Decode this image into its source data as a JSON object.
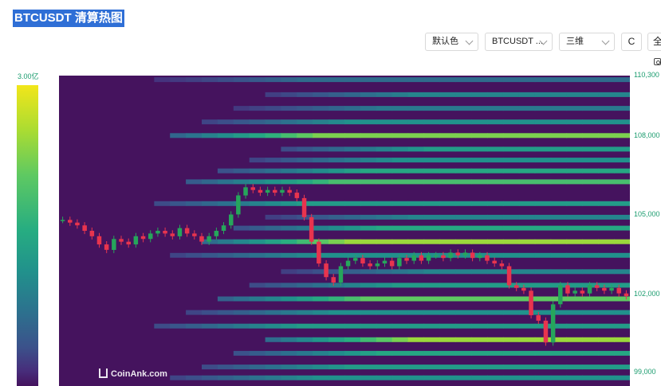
{
  "header": {
    "title": "BTCUSDT 清算热图"
  },
  "toolbar": {
    "color_scheme": "默认色",
    "symbol": "BTCUSDT ...",
    "view_mode": "三维",
    "refresh_icon": "C",
    "fullscreen_label": "全"
  },
  "legend": {
    "max_label": "3.00亿",
    "colors": [
      "#45135e",
      "#472d7b",
      "#3b528b",
      "#2c728e",
      "#21918c",
      "#27ad81",
      "#5ec962",
      "#aadc32",
      "#f2e61a"
    ]
  },
  "watermark": "CoinAnk.com",
  "chart_data": {
    "type": "heatmap",
    "title": "BTCUSDT 清算热图",
    "y_axis": {
      "ticks": [
        "110,300",
        "108,000",
        "105,000",
        "102,000",
        "99,000"
      ],
      "tick_values": [
        110300,
        108000,
        105000,
        102000,
        99000
      ],
      "range": [
        98900,
        110300
      ],
      "position": "right"
    },
    "colorbar": {
      "max": "3.00亿",
      "min": 0
    },
    "price_series": {
      "name": "BTCUSDT",
      "values": [
        105000,
        104900,
        104800,
        104600,
        104400,
        104100,
        103900,
        104300,
        104200,
        104100,
        104400,
        104300,
        104500,
        104600,
        104500,
        104400,
        104700,
        104500,
        104400,
        104200,
        104400,
        104600,
        104800,
        105200,
        105900,
        106200,
        106100,
        106000,
        106100,
        106000,
        106100,
        106000,
        105800,
        105100,
        104200,
        103400,
        102900,
        102700,
        103300,
        103500,
        103600,
        103400,
        103300,
        103400,
        103500,
        103300,
        103600,
        103500,
        103700,
        103500,
        103700,
        103700,
        103600,
        103800,
        103700,
        103800,
        103600,
        103700,
        103500,
        103400,
        103300,
        102600,
        102500,
        102400,
        101500,
        101300,
        100500,
        101900,
        102600,
        102300,
        102400,
        102300,
        102600,
        102500,
        102400,
        102500,
        102300,
        102200
      ]
    },
    "liquidation_bands": [
      {
        "price": 110150,
        "intensity": 0.35
      },
      {
        "price": 109600,
        "intensity": 0.45
      },
      {
        "price": 109100,
        "intensity": 0.4
      },
      {
        "price": 108600,
        "intensity": 0.5
      },
      {
        "price": 108100,
        "intensity": 0.8
      },
      {
        "price": 107600,
        "intensity": 0.55
      },
      {
        "price": 107200,
        "intensity": 0.5
      },
      {
        "price": 106800,
        "intensity": 0.6
      },
      {
        "price": 106400,
        "intensity": 0.7
      },
      {
        "price": 105600,
        "intensity": 0.55
      },
      {
        "price": 105100,
        "intensity": 0.45
      },
      {
        "price": 104700,
        "intensity": 0.6
      },
      {
        "price": 104200,
        "intensity": 0.85
      },
      {
        "price": 103700,
        "intensity": 0.5
      },
      {
        "price": 103100,
        "intensity": 0.45
      },
      {
        "price": 102600,
        "intensity": 0.55
      },
      {
        "price": 102100,
        "intensity": 0.75
      },
      {
        "price": 101600,
        "intensity": 0.5
      },
      {
        "price": 101100,
        "intensity": 0.55
      },
      {
        "price": 100600,
        "intensity": 0.85
      },
      {
        "price": 100100,
        "intensity": 0.6
      },
      {
        "price": 99600,
        "intensity": 0.55
      },
      {
        "price": 99200,
        "intensity": 0.5
      }
    ]
  }
}
